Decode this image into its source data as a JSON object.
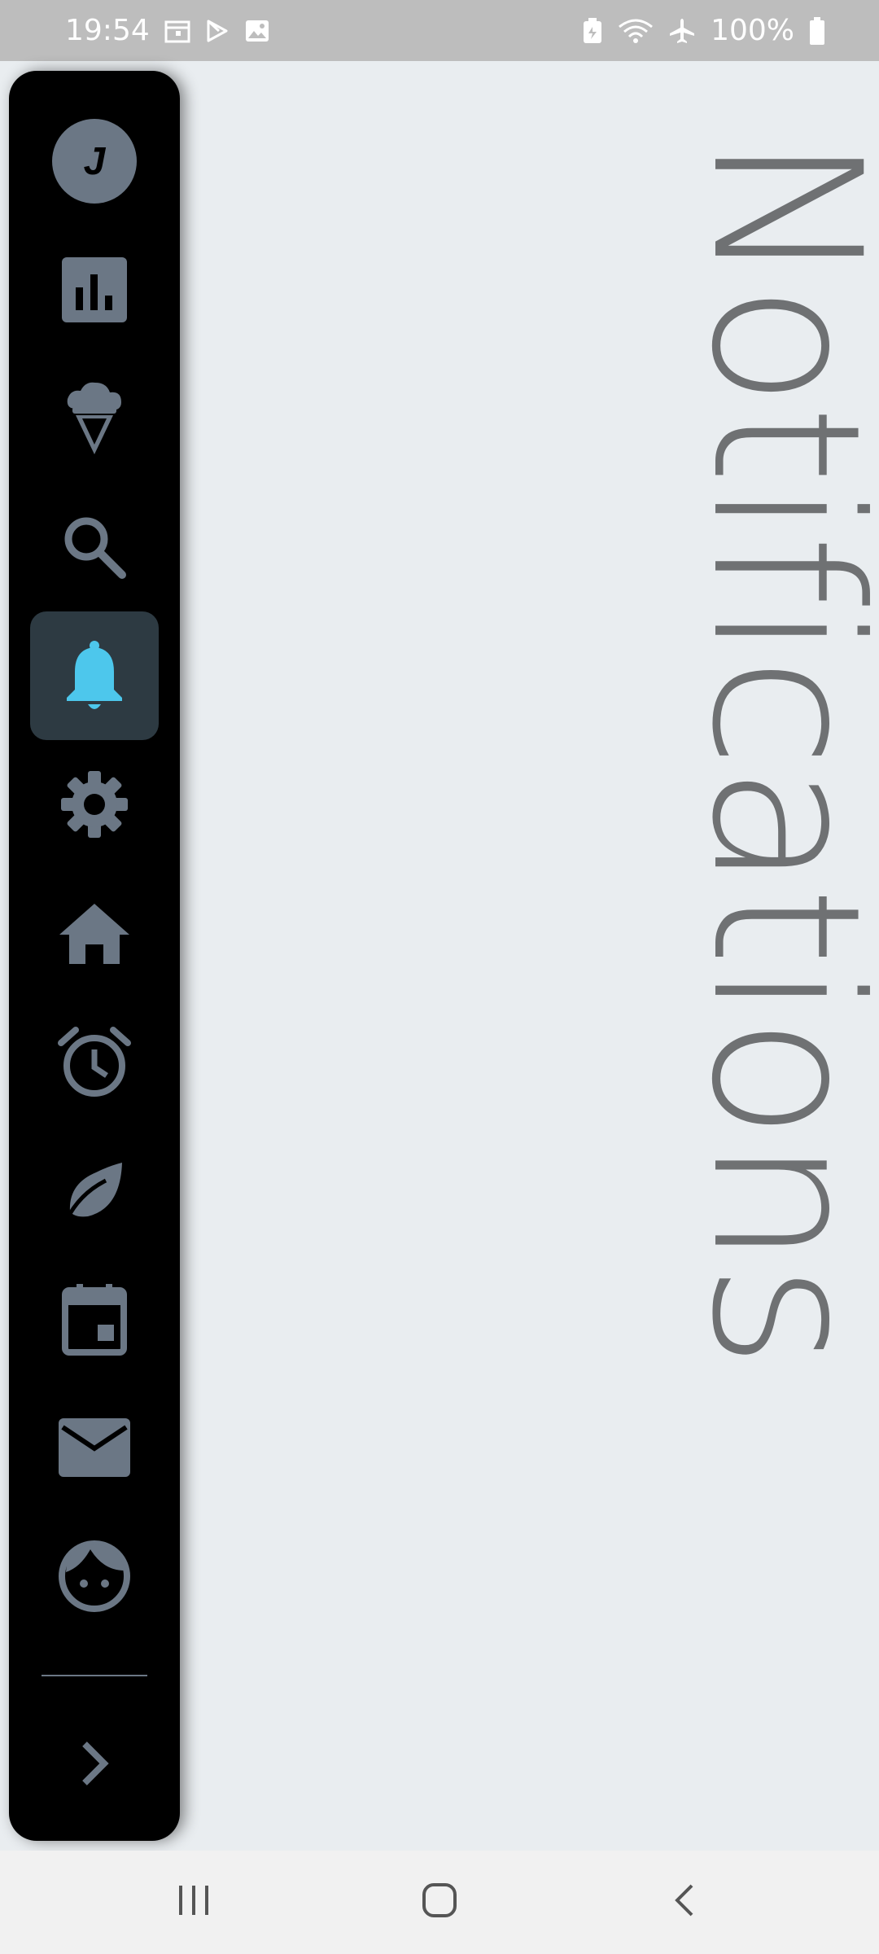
{
  "status_bar": {
    "time": "19:54",
    "icons_left": [
      "calendar-icon",
      "play-store-icon",
      "image-icon"
    ],
    "icons_right": [
      "battery-saver-icon",
      "wifi-icon",
      "airplane-icon",
      "battery-icon"
    ],
    "battery": "100%"
  },
  "page": {
    "title": "Notifications"
  },
  "nav_rail": {
    "avatar_initial": "J",
    "items": [
      {
        "icon": "bar-chart-icon",
        "active": false
      },
      {
        "icon": "ice-cream-icon",
        "active": false
      },
      {
        "icon": "search-icon",
        "active": false
      },
      {
        "icon": "bell-icon",
        "active": true
      },
      {
        "icon": "gear-icon",
        "active": false
      },
      {
        "icon": "home-icon",
        "active": false
      },
      {
        "icon": "alarm-icon",
        "active": false
      },
      {
        "icon": "leaf-icon",
        "active": false
      },
      {
        "icon": "calendar-icon",
        "active": false
      },
      {
        "icon": "mail-icon",
        "active": false
      },
      {
        "icon": "face-icon",
        "active": false
      }
    ],
    "expand_icon": "chevron-right-icon"
  },
  "colors": {
    "rail_bg": "#000000",
    "icon": "#6b7785",
    "active_bg": "#2d3a42",
    "active_icon": "#4dc7ec",
    "content_bg": "#e9edf0",
    "title": "#6f7173"
  },
  "system_nav": [
    "recents-icon",
    "home-circle-icon",
    "back-icon"
  ]
}
